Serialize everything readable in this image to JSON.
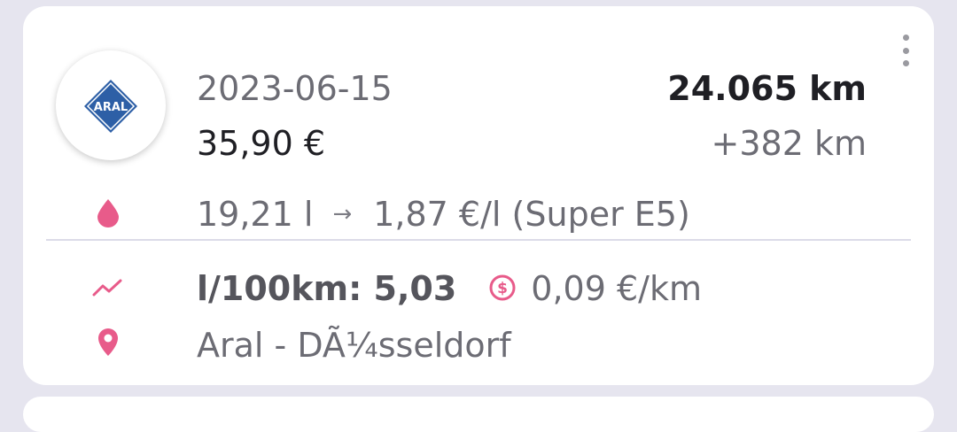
{
  "entry": {
    "brand_logo_text": "ARAL",
    "date": "2023-06-15",
    "price": "35,90 €",
    "odometer": "24.065 km",
    "distance_delta": "+382 km",
    "fuel_amount": "19,21 l",
    "arrow": "→",
    "price_per_liter": "1,87 €/l (Super E5)",
    "consumption": "l/100km: 5,03",
    "cost_per_km": "0,09 €/km",
    "station": "Aral - DÃ¼sseldorf"
  },
  "icons": {
    "menu": "more-vert-icon",
    "fuel": "drop-icon",
    "consumption": "trending-icon",
    "cost": "dollar-circle-icon",
    "location": "location-pin-icon"
  },
  "colors": {
    "accent": "#e85b8a",
    "aral_blue": "#2d5fa6"
  }
}
